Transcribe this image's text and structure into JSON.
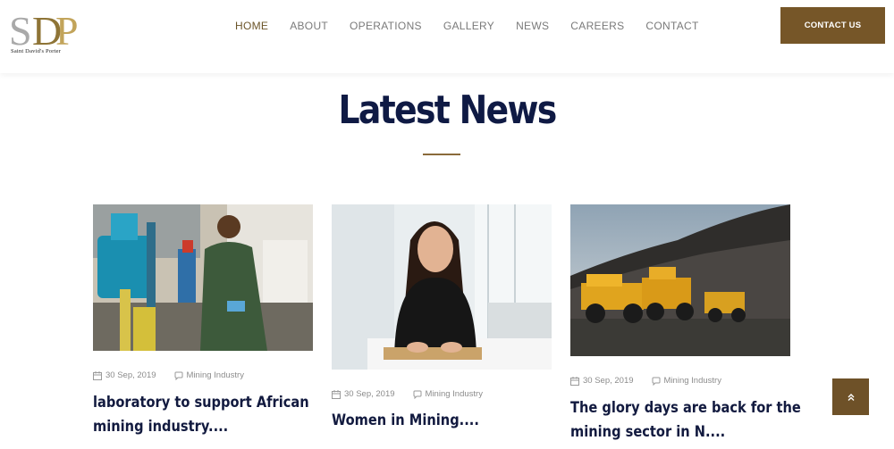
{
  "brand": {
    "logo_letters": "SDP",
    "tagline": "Saint David's Porter"
  },
  "nav": {
    "items": [
      {
        "label": "HOME",
        "active": true
      },
      {
        "label": "ABOUT"
      },
      {
        "label": "OPERATIONS"
      },
      {
        "label": "GALLERY"
      },
      {
        "label": "NEWS"
      },
      {
        "label": "CAREERS"
      },
      {
        "label": "CONTACT"
      }
    ],
    "cta_label": "CONTACT US"
  },
  "section": {
    "title": "Latest News"
  },
  "posts": [
    {
      "date": "30 Sep, 2019",
      "category": "Mining Industry",
      "title_line1": "laboratory to support African",
      "title_line2": "mining industry...."
    },
    {
      "date": "30 Sep, 2019",
      "category": "Mining Industry",
      "title_line1": "Women in Mining...."
    },
    {
      "date": "30 Sep, 2019",
      "category": "Mining Industry",
      "title_line1": "The glory days are back for the",
      "title_line2": "mining sector in N...."
    }
  ],
  "colors": {
    "brand_brown": "#765628",
    "title_navy": "#0f1a44"
  }
}
